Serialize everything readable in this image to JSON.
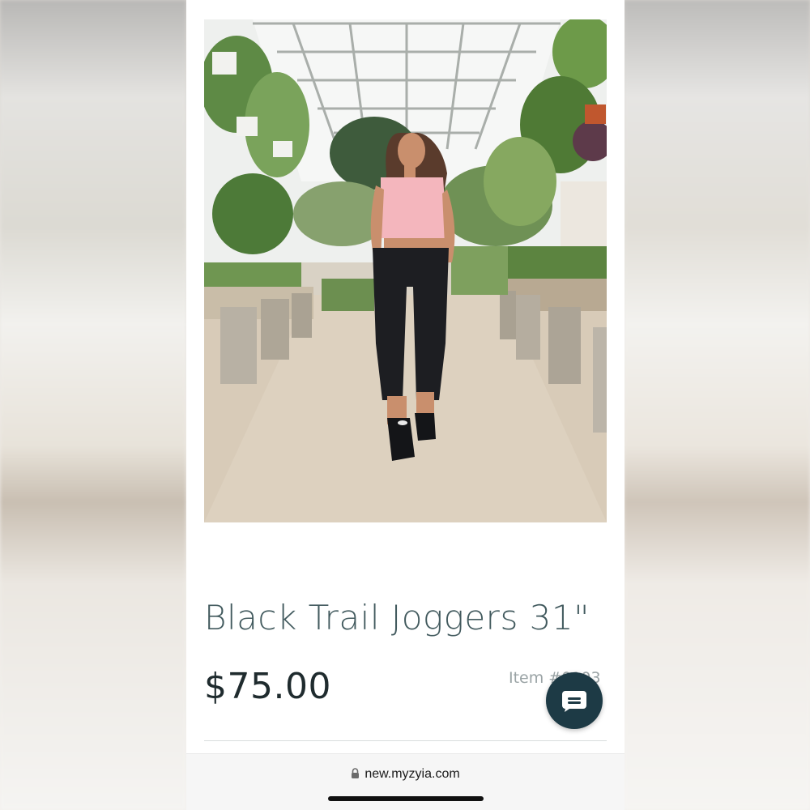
{
  "product": {
    "title": "Black Trail Joggers 31\"",
    "price": "$75.00",
    "item_label": "Item #0103"
  },
  "browser": {
    "url": "new.myzyia.com"
  },
  "icons": {
    "lock": "lock-icon",
    "chat": "chat-bubble-icon"
  },
  "colors": {
    "title": "#425a5e",
    "price": "#1f2b2e",
    "chat_button": "#1d3a45"
  }
}
